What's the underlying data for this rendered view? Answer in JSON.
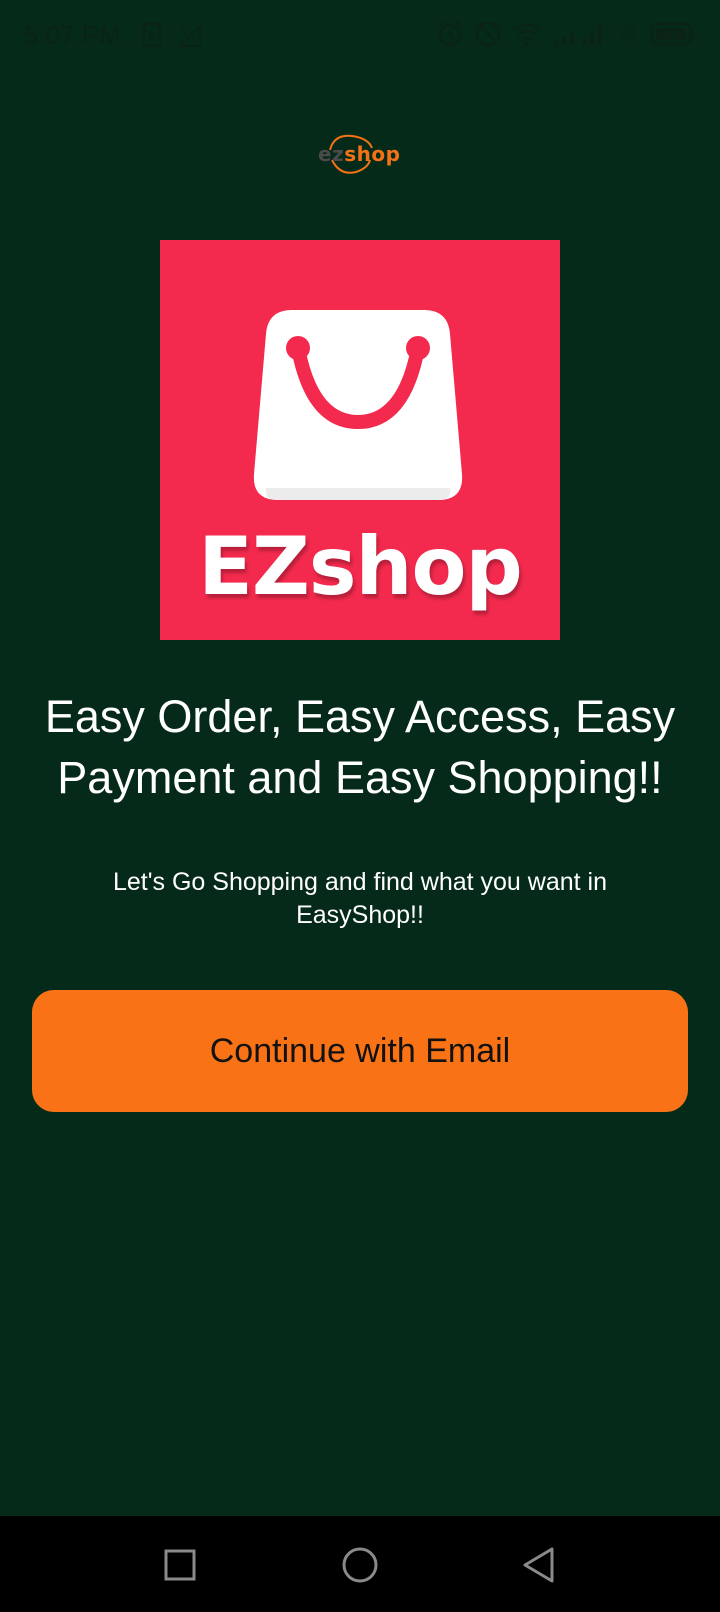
{
  "status_bar": {
    "time": "5:07 PM",
    "net_speed_value": "2.2",
    "net_speed_unit": "K/s",
    "battery": "88",
    "icons": [
      "screen-record-icon",
      "no-sim-signal-icon",
      "alarm-icon",
      "do-not-disturb-icon",
      "wifi-icon",
      "signal-bars-icon",
      "battery-icon"
    ]
  },
  "header": {
    "logo_ez": "ez",
    "logo_shop": "shop"
  },
  "app_logo": {
    "text": "EZshop",
    "background_color": "#f32a4d",
    "icon": "shopping-bag-icon"
  },
  "main": {
    "headline": "Easy Order, Easy Access, Easy Payment and Easy Shopping!!",
    "subtext": "Let's Go Shopping and find what you want in EasyShop!!",
    "cta_label": "Continue with Email",
    "cta_color": "#f97316",
    "background_color": "#052a19"
  },
  "nav_bar": {
    "icons": [
      "recents-square-icon",
      "home-circle-icon",
      "back-triangle-icon"
    ]
  }
}
